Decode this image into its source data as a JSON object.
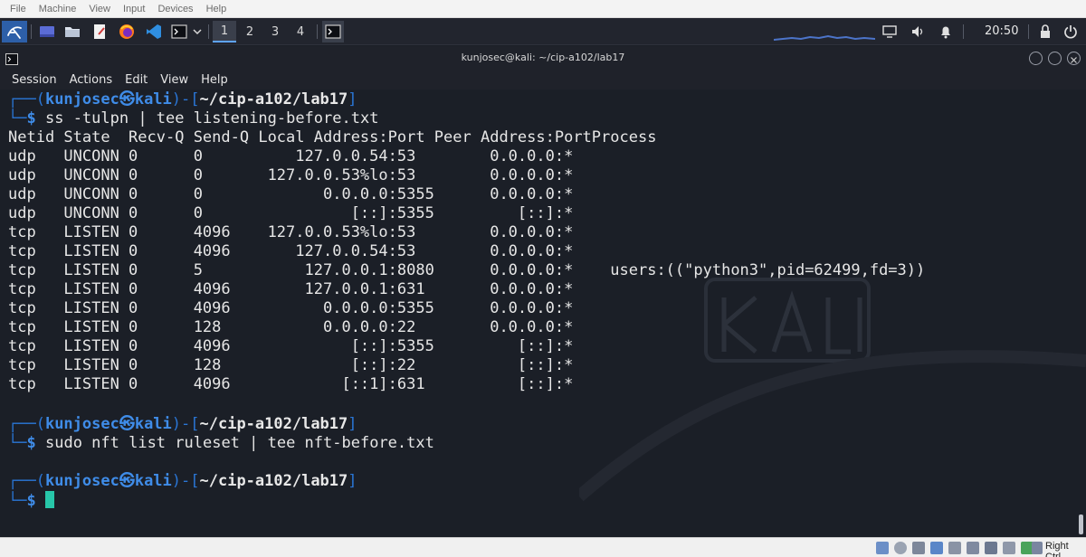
{
  "vbox_menu": [
    "File",
    "Machine",
    "View",
    "Input",
    "Devices",
    "Help"
  ],
  "panel": {
    "workspaces": [
      "1",
      "2",
      "3",
      "4"
    ],
    "clock": "20:50",
    "icons": [
      "kali-menu-icon",
      "desktop-icon",
      "file-manager-icon",
      "text-editor-icon",
      "firefox-icon",
      "vscode-icon",
      "terminal-icon",
      "chevron-down-icon",
      "terminal-task-icon",
      "display-icon",
      "volume-icon",
      "notification-bell-icon",
      "lock-icon",
      "power-icon"
    ]
  },
  "terminal": {
    "title": "kunjosec@kali: ~/cip-a102/lab17",
    "menu": [
      "Session",
      "Actions",
      "Edit",
      "View",
      "Help"
    ],
    "prompt": {
      "frame_top": "┌──(",
      "user": "kunjosec㉿kali",
      "frame_mid": ")-[",
      "path": "~/cip-a102/lab17",
      "frame_end": "]",
      "frame_bottom": "└─",
      "dollar": "$"
    },
    "commands": [
      "ss -tulpn | tee listening-before.txt",
      "sudo nft list ruleset | tee nft-before.txt"
    ],
    "output": [
      "Netid State  Recv-Q Send-Q Local Address:Port Peer Address:PortProcess",
      "udp   UNCONN 0      0          127.0.0.54:53        0.0.0.0:*",
      "udp   UNCONN 0      0       127.0.0.53%lo:53        0.0.0.0:*",
      "udp   UNCONN 0      0             0.0.0.0:5355      0.0.0.0:*",
      "udp   UNCONN 0      0                [::]:5355         [::]:*",
      "tcp   LISTEN 0      4096    127.0.0.53%lo:53        0.0.0.0:*",
      "tcp   LISTEN 0      4096       127.0.0.54:53        0.0.0.0:*",
      "tcp   LISTEN 0      5           127.0.0.1:8080      0.0.0.0:*    users:((\"python3\",pid=62499,fd=3))",
      "tcp   LISTEN 0      4096        127.0.0.1:631       0.0.0.0:*",
      "tcp   LISTEN 0      4096          0.0.0.0:5355      0.0.0.0:*",
      "tcp   LISTEN 0      128           0.0.0.0:22        0.0.0.0:*",
      "tcp   LISTEN 0      4096             [::]:5355         [::]:*",
      "tcp   LISTEN 0      128              [::]:22           [::]:*",
      "tcp   LISTEN 0      4096            [::1]:631          [::]:*"
    ]
  },
  "status_bar": {
    "host_key": "Right Ctrl"
  },
  "colors": {
    "terminal_bg": "#1b1f27",
    "prompt_blue": "#3f8ce8",
    "cursor": "#27c6a9",
    "panel_bg": "#22252e"
  }
}
